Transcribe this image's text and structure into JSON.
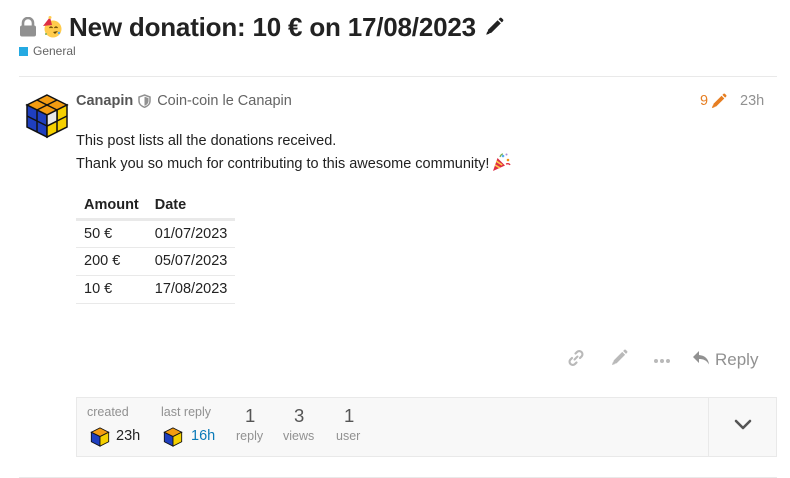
{
  "topic": {
    "title": "New donation: 10 € on 17/08/2023",
    "category": "General",
    "category_color": "#25AAE2"
  },
  "post": {
    "username": "Canapin",
    "user_title": "Coin-coin le Canapin",
    "edit_count": "9",
    "date": "23h",
    "body_line1": "This post lists all the donations received.",
    "body_line2": "Thank you so much for contributing to this awesome community!"
  },
  "table": {
    "headers": [
      "Amount",
      "Date"
    ],
    "rows": [
      [
        "50 €",
        "01/07/2023"
      ],
      [
        "200 €",
        "05/07/2023"
      ],
      [
        "10 €",
        "17/08/2023"
      ]
    ]
  },
  "actions": {
    "reply_label": "Reply"
  },
  "topic_map": {
    "created_label": "created",
    "created_value": "23h",
    "last_reply_label": "last reply",
    "last_reply_value": "16h",
    "replies_count": "1",
    "replies_label": "reply",
    "views_count": "3",
    "views_label": "views",
    "users_count": "1",
    "users_label": "user"
  },
  "colors": {
    "accent_orange": "#E67E22",
    "link_blue": "#0A7AB8",
    "muted": "#919191"
  },
  "icons": [
    "lock-icon",
    "party-face-icon",
    "pencil-icon",
    "shield-icon",
    "party-popper-icon",
    "link-icon",
    "ellipsis-icon",
    "reply-icon",
    "chevron-down-icon"
  ]
}
